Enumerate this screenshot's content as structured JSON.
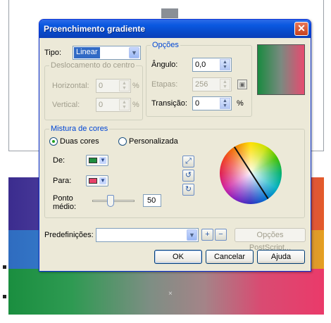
{
  "dialog": {
    "title": "Preenchimento gradiente",
    "close_icon": "close-icon",
    "tipo_label": "Tipo:",
    "tipo_value": "Linear",
    "offset_group": {
      "title": "Deslocamento do centro",
      "horizontal_label": "Horizontal:",
      "horizontal_value": "0",
      "vertical_label": "Vertical:",
      "vertical_value": "0",
      "percent": "%"
    },
    "options_group": {
      "title": "Opções",
      "angle_label": "Ângulo:",
      "angle_value": "0,0",
      "steps_label": "Etapas:",
      "steps_value": "256",
      "transition_label": "Transição:",
      "transition_value": "0",
      "percent": "%"
    },
    "blend_group": {
      "title": "Mistura de cores",
      "two_colors_label": "Duas cores",
      "custom_label": "Personalizada",
      "selected_mode": "Duas cores",
      "from_label": "De:",
      "to_label": "Para:",
      "from_color": "#1e8e3e",
      "to_color": "#e8426a",
      "midpoint_label_line1": "Ponto",
      "midpoint_label_line2": "médio:",
      "midpoint_value": "50"
    },
    "presets_label": "Predefinições:",
    "presets_value": "",
    "postscript_button": "Opções PostScript...",
    "ok_button": "OK",
    "cancel_button": "Cancelar",
    "help_button": "Ajuda"
  },
  "colors": {
    "title_bar": "#0a58e0",
    "dialog_bg": "#ece9d8",
    "group_title": "#0046d5",
    "close_button": "#d8542c"
  }
}
